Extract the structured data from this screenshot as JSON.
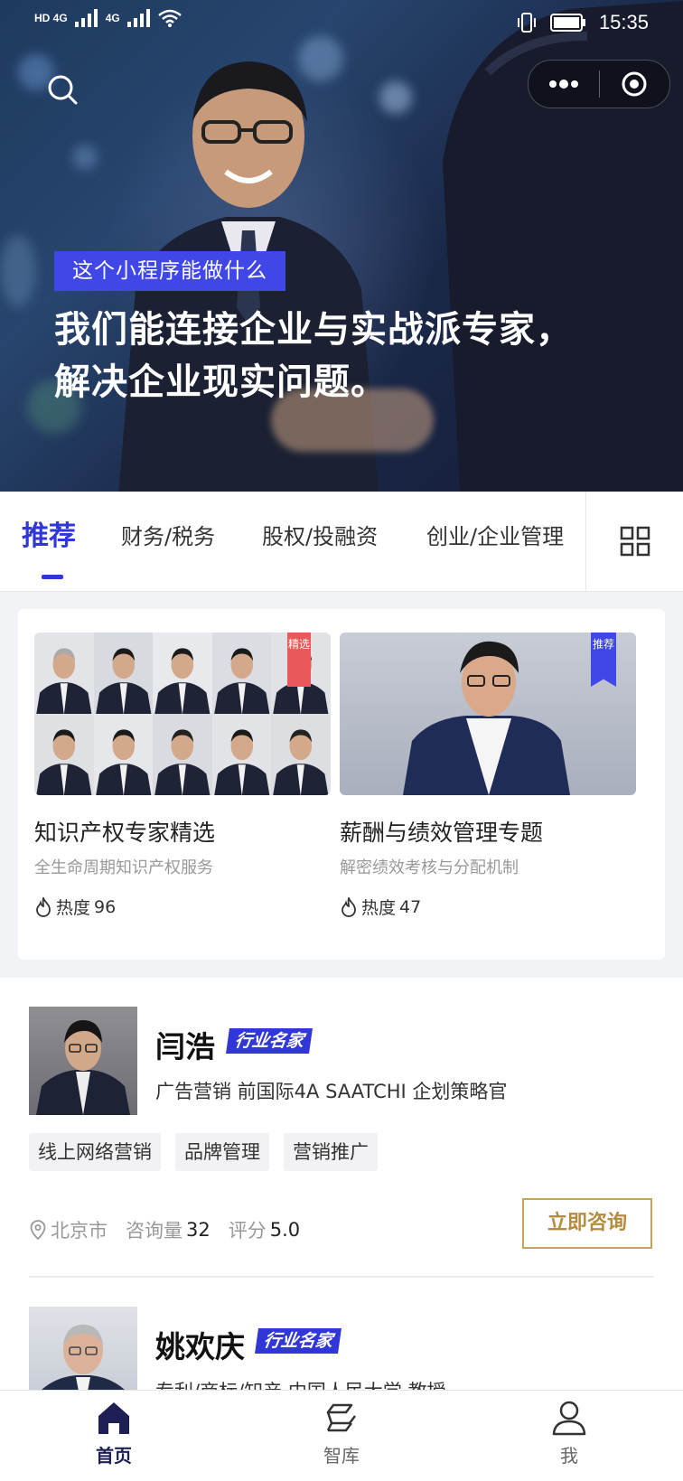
{
  "status_bar": {
    "time": "15:35",
    "network_left": "HD 4G",
    "network_right": "4G"
  },
  "hero": {
    "tag": "这个小程序能做什么",
    "title_line1": "我们能连接企业与实战派专家，",
    "title_line2": "解决企业现实问题。"
  },
  "tabs": [
    {
      "label": "推荐",
      "active": true
    },
    {
      "label": "财务/税务",
      "active": false
    },
    {
      "label": "股权/投融资",
      "active": false
    },
    {
      "label": "创业/企业管理",
      "active": false
    }
  ],
  "topics": [
    {
      "badge": "精选",
      "title": "知识产权专家精选",
      "subtitle": "全生命周期知识产权服务",
      "heat_label": "热度",
      "heat_value": "96"
    },
    {
      "badge": "推荐",
      "title": "薪酬与绩效管理专题",
      "subtitle": "解密绩效考核与分配机制",
      "heat_label": "热度",
      "heat_value": "47"
    }
  ],
  "experts": [
    {
      "name": "闫浩",
      "rank": "行业名家",
      "description": "广告营销  前国际4A SAATCHI  企划策略官",
      "tags": [
        "线上网络营销",
        "品牌管理",
        "营销推广"
      ],
      "city": "北京市",
      "consult_label": "咨询量",
      "consult_count": "32",
      "score_label": "评分",
      "score": "5.0",
      "button": "立即咨询"
    },
    {
      "name": "姚欢庆",
      "rank": "行业名家",
      "description": "专利/商标/知产  中国人民大学  教授"
    }
  ],
  "bottom_nav": [
    {
      "label": "首页",
      "icon": "home-icon",
      "active": true
    },
    {
      "label": "智库",
      "icon": "think-tank-icon",
      "active": false
    },
    {
      "label": "我",
      "icon": "user-icon",
      "active": false
    }
  ],
  "colors": {
    "accent": "#3037d6",
    "tag_blue": "#3f47e6",
    "gold": "#c7a259",
    "nav_active": "#1d1f55"
  }
}
